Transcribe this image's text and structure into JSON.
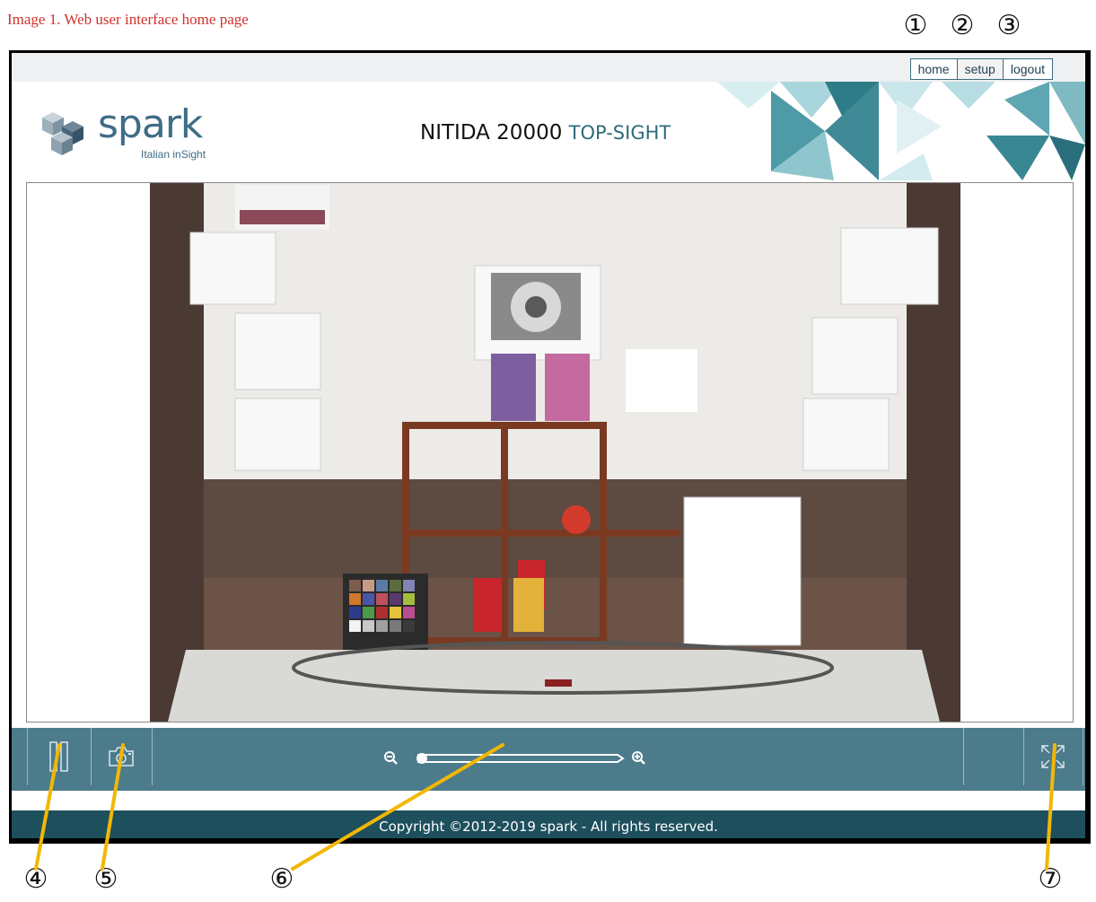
{
  "caption": "Image 1. Web user interface home page",
  "callouts": [
    "①",
    "②",
    "③",
    "④",
    "⑤",
    "⑥",
    "⑦"
  ],
  "nav": {
    "home": "home",
    "setup": "setup",
    "logout": "logout"
  },
  "brand": {
    "name": "spark",
    "tagline": "Italian inSight"
  },
  "product": {
    "model": "NITIDA 20000",
    "variant": "TOP-SIGHT"
  },
  "controls": {
    "pause_icon": "pause-icon",
    "snapshot_icon": "camera-icon",
    "zoom_out_icon": "zoom-out-icon",
    "zoom_in_icon": "zoom-in-icon",
    "fullscreen_icon": "fullscreen-icon",
    "zoom_level": 0
  },
  "footer": {
    "copyright": "Copyright ©2012-2019 spark - All rights reserved."
  },
  "colors": {
    "control_bar": "#4c7b8c",
    "footer": "#1e4f5d",
    "brand": "#3f6d86",
    "accent": "#2f6b7c",
    "caption": "#d0312d",
    "leader": "#f2b705"
  }
}
